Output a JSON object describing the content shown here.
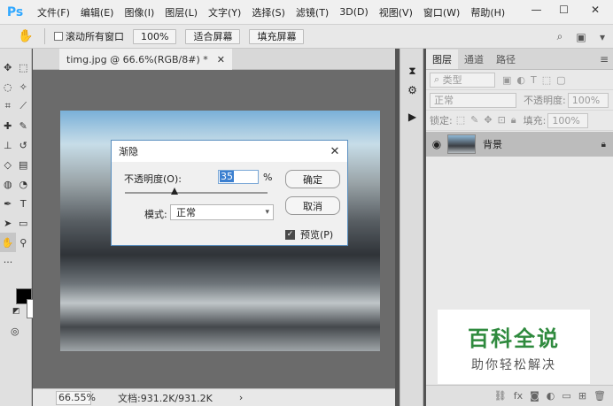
{
  "app": {
    "logo": "Ps"
  },
  "menu": {
    "items": [
      "文件(F)",
      "编辑(E)",
      "图像(I)",
      "图层(L)",
      "文字(Y)",
      "选择(S)",
      "滤镜(T)",
      "3D(D)",
      "视图(V)",
      "窗口(W)",
      "帮助(H)"
    ]
  },
  "window_controls": {
    "minimize": "—",
    "maximize": "☐",
    "close": "✕"
  },
  "options": {
    "scroll_all_label": "滚动所有窗口",
    "zoom_100": "100%",
    "fit_screen": "适合屏幕",
    "fill_screen": "填充屏幕"
  },
  "document": {
    "tab_title": "timg.jpg @ 66.6%(RGB/8#) *",
    "tab_close": "✕"
  },
  "status": {
    "zoom": "66.55%",
    "doc_info": "文档:931.2K/931.2K",
    "arrow": "›"
  },
  "layers": {
    "tabs": [
      "图层",
      "通道",
      "路径"
    ],
    "filter_kind": "类型",
    "blend_mode": "正常",
    "opacity_label": "不透明度:",
    "opacity_value": "100%",
    "lock_label": "锁定:",
    "fill_label": "填充:",
    "fill_value": "100%",
    "layer_name": "背景"
  },
  "dialog": {
    "title": "渐隐",
    "opacity_label": "不透明度(O):",
    "opacity_value": "35",
    "opacity_fraction": 0.35,
    "percent": "%",
    "mode_label": "模式:",
    "mode_value": "正常",
    "ok": "确定",
    "cancel": "取消",
    "preview_label": "预览(P)"
  },
  "watermark": {
    "title": "百科全说",
    "subtitle": "助你轻松解决"
  },
  "colors": {
    "accent": "#31a8ff",
    "watermark_green": "#2f8a3e"
  }
}
